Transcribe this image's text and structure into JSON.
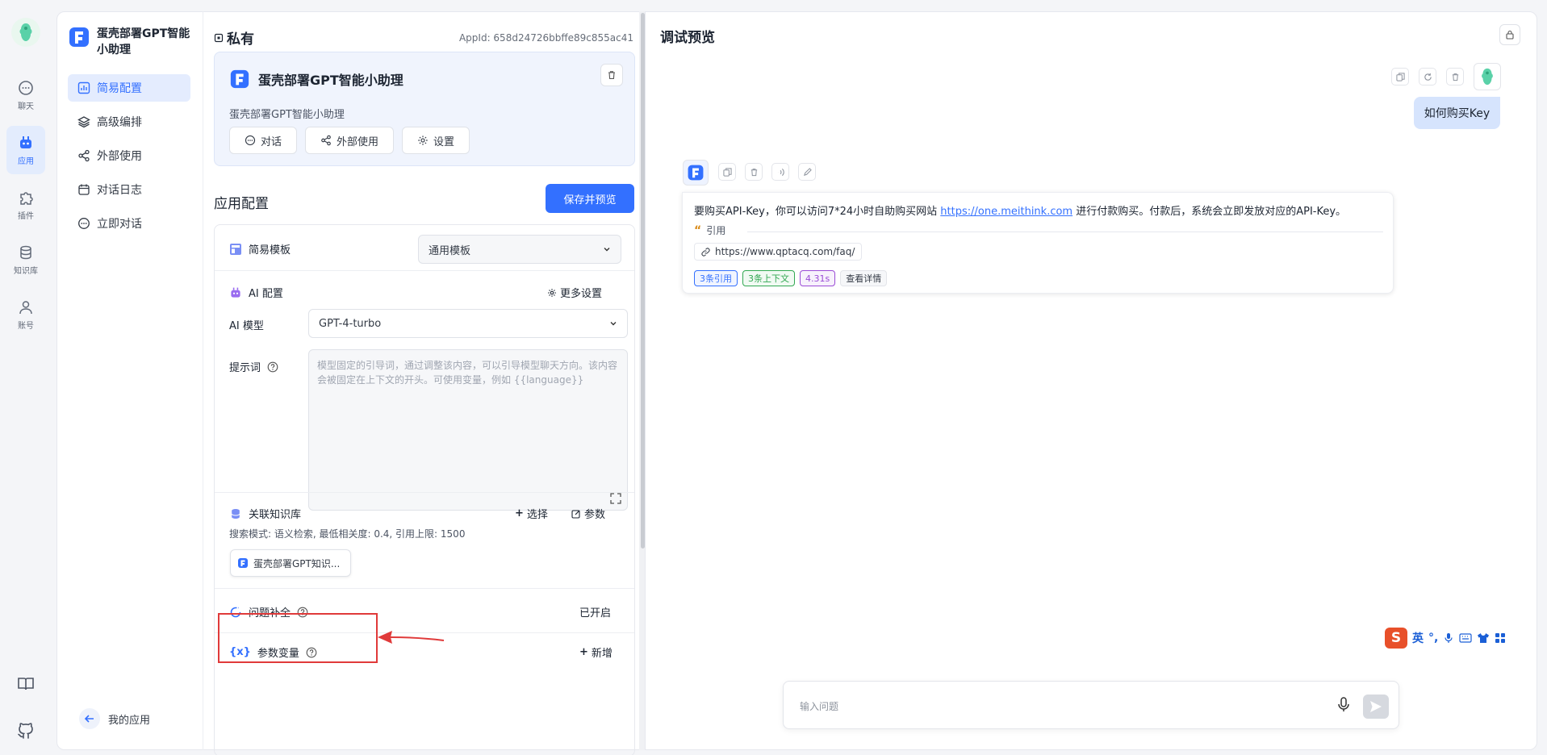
{
  "rail": {
    "items": [
      {
        "label": "聊天",
        "icon": "chat-icon"
      },
      {
        "label": "应用",
        "icon": "robot-icon",
        "active": true
      },
      {
        "label": "插件",
        "icon": "puzzle-icon"
      },
      {
        "label": "知识库",
        "icon": "database-icon"
      },
      {
        "label": "账号",
        "icon": "user-icon"
      }
    ],
    "bottom_icons": [
      "book-icon",
      "github-icon"
    ]
  },
  "appnav": {
    "app_name": "蛋壳部署GPT智能小助理",
    "items": [
      {
        "label": "简易配置",
        "icon": "chart-icon",
        "active": true
      },
      {
        "label": "高级编排",
        "icon": "layers-icon"
      },
      {
        "label": "外部使用",
        "icon": "share-icon"
      },
      {
        "label": "对话日志",
        "icon": "calendar-icon"
      },
      {
        "label": "立即对话",
        "icon": "chat-icon"
      }
    ],
    "my_apps": "我的应用"
  },
  "config": {
    "visibility": "私有",
    "app_id": "AppId: 658d24726bbffe89c855ac41",
    "card": {
      "title": "蛋壳部署GPT智能小助理",
      "desc": "蛋壳部署GPT智能小助理",
      "buttons": [
        {
          "label": "对话",
          "icon": "chat-icon"
        },
        {
          "label": "外部使用",
          "icon": "share-icon"
        },
        {
          "label": "设置",
          "icon": "gear-icon"
        }
      ]
    },
    "section_title": "应用配置",
    "save_button": "保存并预览",
    "template": {
      "label": "简易模板",
      "value": "通用模板"
    },
    "ai": {
      "label": "AI 配置",
      "more": "更多设置",
      "model_label": "AI 模型",
      "model_value": "GPT-4-turbo",
      "prompt_label": "提示词",
      "prompt_placeholder": "模型固定的引导词，通过调整该内容，可以引导模型聊天方向。该内容会被固定在上下文的开头。可使用变量，例如 {{language}}"
    },
    "kb": {
      "label": "关联知识库",
      "select": "选择",
      "params": "参数",
      "search_mode": "搜索模式: 语义检索, 最低相关度: 0.4, 引用上限: 1500",
      "chip": "蛋壳部署GPT知识..."
    },
    "question_complete": {
      "label": "问题补全",
      "status": "已开启"
    },
    "variables": {
      "label": "参数变量",
      "add": "新增"
    }
  },
  "preview": {
    "title": "调试预览",
    "user_message": "如何购买Key",
    "bot": {
      "text_before": "要购买API-Key，你可以访问7*24小时自助购买网站 ",
      "link": "https://one.meithink.com",
      "text_after": " 进行付款购买。付款后，系统会立即发放对应的API-Key。",
      "quote_label": "引用",
      "citation": "https://www.qptacq.com/faq/",
      "tags": [
        "3条引用",
        "3条上下文",
        "4.31s",
        "查看详情"
      ]
    },
    "input_placeholder": "输入问题",
    "ime": {
      "s": "S",
      "lang": "英"
    }
  },
  "colors": {
    "accent": "#3370ff",
    "red_highlight": "#e03a3a"
  }
}
